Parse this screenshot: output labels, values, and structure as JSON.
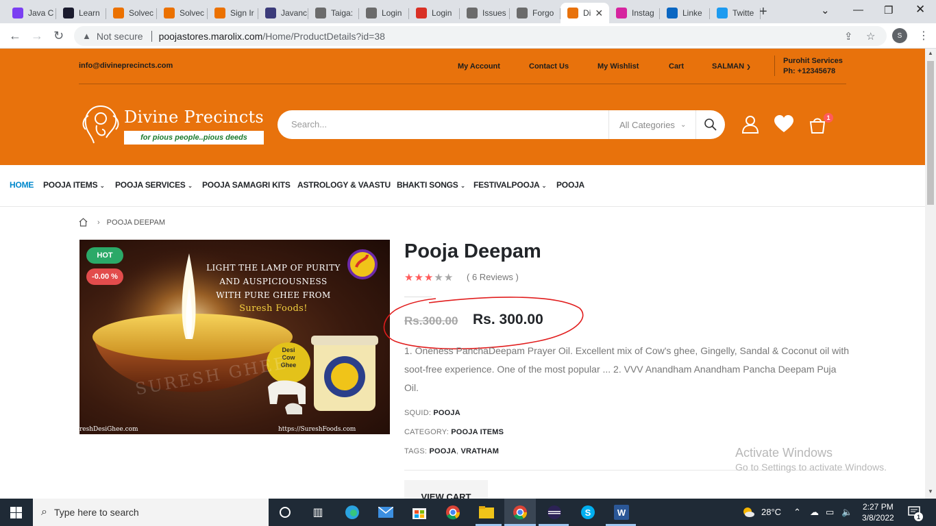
{
  "browser": {
    "tabs": [
      {
        "label": "Java C",
        "icon": "pycharm-icon",
        "color": "#7b3ff2"
      },
      {
        "label": "Learn",
        "icon": "codewars-icon",
        "color": "#1b1b2e"
      },
      {
        "label": "Solvec",
        "icon": "chegg-icon",
        "color": "#eb7100"
      },
      {
        "label": "Solvec",
        "icon": "chegg-icon",
        "color": "#eb7100"
      },
      {
        "label": "Sign Ir",
        "icon": "chegg-icon",
        "color": "#eb7100"
      },
      {
        "label": "Javanc",
        "icon": "javanc-icon",
        "color": "#3b3b7a"
      },
      {
        "label": "Taiga:",
        "icon": "taiga-icon",
        "color": "#6b6b6b"
      },
      {
        "label": "Login",
        "icon": "taiga-icon",
        "color": "#6b6b6b"
      },
      {
        "label": "Login",
        "icon": "gmail-icon",
        "color": "#d93025"
      },
      {
        "label": "Issues",
        "icon": "taiga-icon",
        "color": "#6b6b6b"
      },
      {
        "label": "Forgo",
        "icon": "taiga-icon",
        "color": "#6b6b6b"
      },
      {
        "label": "Di",
        "icon": "divine-icon",
        "color": "#e8720c",
        "active": true
      },
      {
        "label": "Instag",
        "icon": "instagram-icon",
        "color": "#d6249f"
      },
      {
        "label": "Linke",
        "icon": "linkedin-icon",
        "color": "#0a66c2"
      },
      {
        "label": "Twitte",
        "icon": "twitter-icon",
        "color": "#1d9bf0"
      }
    ],
    "new_tab": "+",
    "not_secure": "Not secure",
    "url_host": "poojastores.marolix.com",
    "url_path": "/Home/ProductDetails?id=38",
    "profile_initial": "S"
  },
  "header": {
    "email": "info@divineprecincts.com",
    "links": [
      "My Account",
      "Contact Us",
      "My Wishlist",
      "Cart",
      "SALMAN"
    ],
    "purohit_title": "Purohit Services",
    "purohit_phone": "Ph: +12345678",
    "brand": "Divine Precincts",
    "tagline": "for pious people..pious deeds",
    "search_placeholder": "Search...",
    "category_select": "All Categories",
    "cart_count": "1"
  },
  "nav": {
    "items": [
      "HOME",
      "POOJA ITEMS",
      "POOJA SERVICES",
      "POOJA SAMAGRI KITS",
      "ASTROLOGY & VAASTU",
      "BHAKTI SONGS",
      "FESTIVALPOOJA",
      "POOJA"
    ]
  },
  "breadcrumb": {
    "current": "POOJA DEEPAM"
  },
  "product": {
    "badge_hot": "HOT",
    "badge_discount": "-0.00 %",
    "image_text": {
      "line1": "LIGHT THE LAMP OF PURITY",
      "line2": "AND AUSPICIOUSNESS",
      "line3": "WITH PURE GHEE FROM",
      "line4": "Suresh Foods!",
      "jar_label1": "Desi",
      "jar_label2": "Cow",
      "jar_label3": "Ghee",
      "watermark": "SURESH GHEE",
      "left_url": "reshDesiGhee.com",
      "right_url": "https://SureshFoods.com"
    },
    "title": "Pooja Deepam",
    "rating": 3,
    "rating_max": 5,
    "reviews": "( 6 Reviews )",
    "old_price": "Rs.300.00",
    "price": "Rs. 300.00",
    "description": "1. Oneness PanchaDeepam Prayer Oil. Excellent mix of Cow's ghee, Gingelly, Sandal & Coconut oil with soot-free experience. One of the most popular ... 2. VVV Anandham Anandham Pancha Deepam Puja Oil.",
    "squid_label": "SQUID:",
    "squid_value": "POOJA",
    "category_label": "CATEGORY:",
    "category_value": "POOJA ITEMS",
    "tags_label": "TAGS:",
    "tags": [
      "POOJA",
      "VRATHAM"
    ],
    "view_cart": "VIEW CART"
  },
  "watermark": {
    "line1": "Activate Windows",
    "line2": "Go to Settings to activate Windows."
  },
  "taskbar": {
    "search_placeholder": "Type here to search",
    "weather": "28°C",
    "time": "2:27 PM",
    "date": "3/8/2022",
    "notification_count": "1"
  },
  "colors": {
    "header_orange": "#e8720c",
    "nav_active": "#0088cc",
    "star": "#ff5b5b",
    "hot_badge": "#2ba968",
    "discount_badge": "#e24c4c",
    "annotation_circle": "#e11d1d"
  }
}
